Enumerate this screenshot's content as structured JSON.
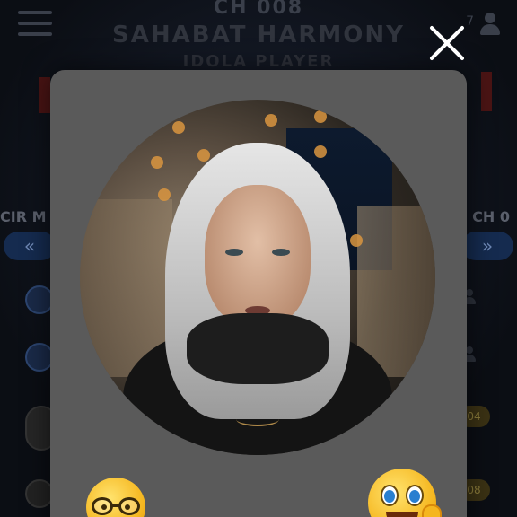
{
  "background": {
    "channel": "CH 008",
    "title": "SAHABAT HARMONY",
    "subtitle": "IDOLA PLAYER",
    "left_label": "CIR M",
    "right_label": "CH 0",
    "prev_label": "«",
    "next_label": "»",
    "count_badge": "7",
    "pill_1": "04",
    "pill_2": "08"
  },
  "modal": {
    "close_label": "",
    "portrait_icon": "profile-photo",
    "reactions": [
      {
        "name": "nerd-face-emoji"
      },
      {
        "name": "smiling-face-emoji"
      }
    ]
  },
  "colors": {
    "modal_bg": "#5a5a5a",
    "page_bg": "#0b0e14",
    "accent_blue": "#152b4f",
    "accent_gold": "#f5b61e"
  }
}
